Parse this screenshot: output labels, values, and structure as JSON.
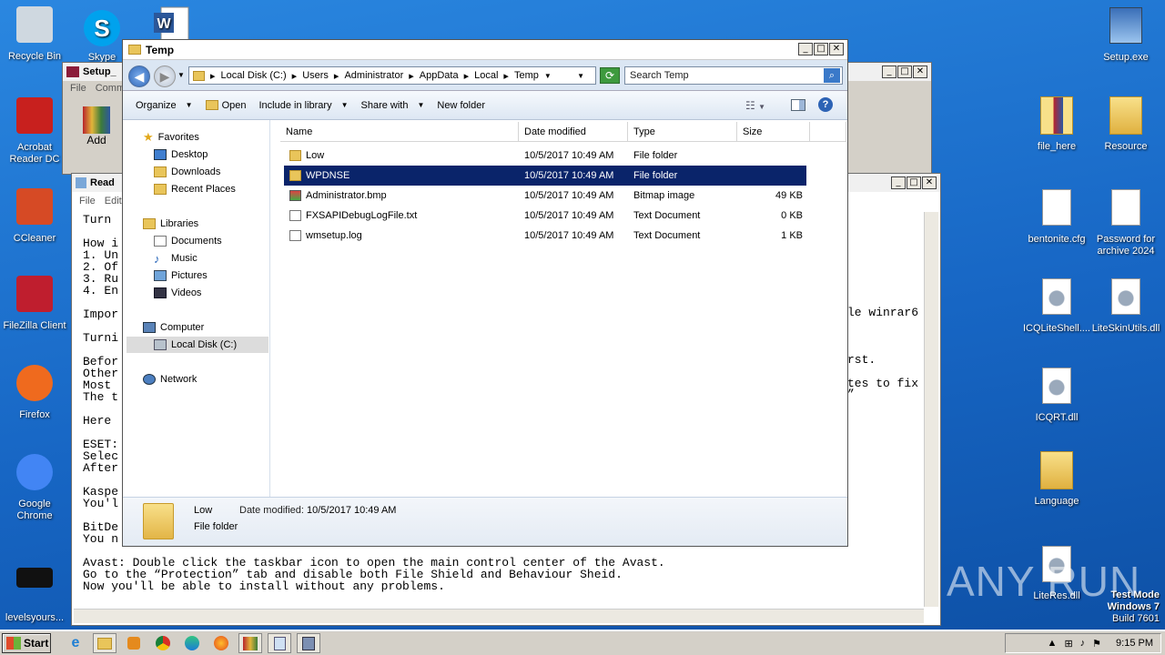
{
  "desktop": {
    "icons_left": [
      {
        "label": "Recycle Bin",
        "icon": "recycle-bin-icon"
      },
      {
        "label": "Acrobat Reader DC",
        "icon": "acrobat-icon"
      },
      {
        "label": "CCleaner",
        "icon": "ccleaner-icon"
      },
      {
        "label": "FileZilla Client",
        "icon": "filezilla-icon"
      },
      {
        "label": "Firefox",
        "icon": "firefox-icon"
      },
      {
        "label": "Google Chrome",
        "icon": "chrome-icon"
      },
      {
        "label": "levelsyours...",
        "icon": "black-file-icon"
      }
    ],
    "icons_top": [
      {
        "label": "Skype",
        "icon": "skype-icon"
      },
      {
        "label": "",
        "icon": "word-icon"
      }
    ],
    "icons_right": [
      {
        "label": "Setup.exe",
        "icon": "setup-icon"
      },
      {
        "label": "file_here",
        "icon": "winrar-folder-icon"
      },
      {
        "label": "Resource",
        "icon": "folder-icon"
      },
      {
        "label": "bentonite.cfg",
        "icon": "file-icon"
      },
      {
        "label": "Password for archive 2024",
        "icon": "file-icon"
      },
      {
        "label": "ICQLiteShell....",
        "icon": "dll-icon"
      },
      {
        "label": "LiteSkinUtils.dll",
        "icon": "dll-icon"
      },
      {
        "label": "ICQRT.dll",
        "icon": "dll-icon"
      },
      {
        "label": "Language",
        "icon": "folder-icon"
      },
      {
        "label": "LiteRes.dll",
        "icon": "dll-icon"
      }
    ],
    "watermark": "ANY RUN",
    "test_mode": [
      "Test Mode",
      "Windows 7",
      "Build 7601"
    ]
  },
  "setup_window": {
    "title": "Setup_",
    "menu": [
      "File",
      "Comm"
    ],
    "add_label": "Add"
  },
  "readme_window": {
    "title": "Read",
    "menu": [
      "File",
      "Edit"
    ],
    "lines": [
      "Turn",
      "",
      "How i",
      "1. Un",
      "2. Of",
      "3. Ru",
      "4. En",
      "",
      "Impor",
      "",
      "Turni",
      "",
      "Befor",
      "Other",
      "Most",
      "The t",
      "",
      "Here",
      "",
      "ESET:",
      "Selec",
      "After",
      "",
      "Kaspe",
      "You'l",
      "",
      "BitDe",
      "You n",
      "",
      "Avast: Double click the taskbar icon to open the main control center of the Avast.",
      "Go to the “Protection” tab and disable both File Shield and Behaviour Sheid.",
      "Now you'll be able to install without any problems."
    ],
    "right_fragments": [
      "le winrar6",
      "rst.",
      "tes to fix",
      "”"
    ]
  },
  "explorer": {
    "title": "Temp",
    "breadcrumb": [
      "Local Disk (C:)",
      "Users",
      "Administrator",
      "AppData",
      "Local",
      "Temp"
    ],
    "search_placeholder": "Search Temp",
    "toolbar": {
      "organize": "Organize",
      "open": "Open",
      "include": "Include in library",
      "share": "Share with",
      "new_folder": "New folder"
    },
    "nav": {
      "favorites": "Favorites",
      "desktop": "Desktop",
      "downloads": "Downloads",
      "recent": "Recent Places",
      "libraries": "Libraries",
      "documents": "Documents",
      "music": "Music",
      "pictures": "Pictures",
      "videos": "Videos",
      "computer": "Computer",
      "local_disk": "Local Disk (C:)",
      "network": "Network"
    },
    "columns": [
      "Name",
      "Date modified",
      "Type",
      "Size"
    ],
    "files": [
      {
        "name": "Low",
        "date": "10/5/2017 10:49 AM",
        "type": "File folder",
        "size": "",
        "icon": "folder-icon",
        "selected": false
      },
      {
        "name": "WPDNSE",
        "date": "10/5/2017 10:49 AM",
        "type": "File folder",
        "size": "",
        "icon": "folder-icon",
        "selected": true
      },
      {
        "name": "Administrator.bmp",
        "date": "10/5/2017 10:49 AM",
        "type": "Bitmap image",
        "size": "49 KB",
        "icon": "bitmap-icon",
        "selected": false
      },
      {
        "name": "FXSAPIDebugLogFile.txt",
        "date": "10/5/2017 10:49 AM",
        "type": "Text Document",
        "size": "0 KB",
        "icon": "text-file-icon",
        "selected": false
      },
      {
        "name": "wmsetup.log",
        "date": "10/5/2017 10:49 AM",
        "type": "Text Document",
        "size": "1 KB",
        "icon": "text-file-icon",
        "selected": false
      }
    ],
    "details": {
      "name": "Low",
      "date_label": "Date modified:",
      "date_value": "10/5/2017 10:49 AM",
      "type": "File folder"
    }
  },
  "taskbar": {
    "start_label": "Start",
    "clock": "9:15 PM"
  }
}
